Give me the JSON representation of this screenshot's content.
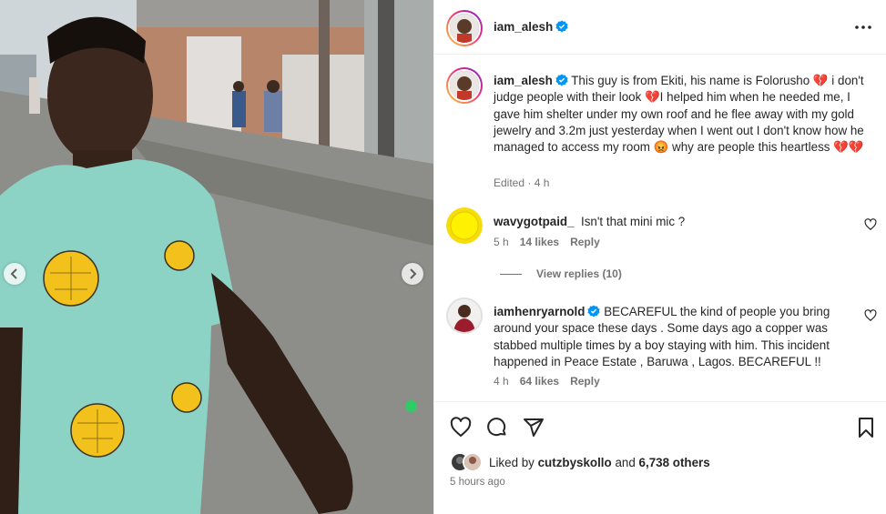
{
  "post": {
    "author": "iam_alesh",
    "caption": "This guy is from Ekiti, his name is Folorusho 💔 i don't judge people with their look 💔I helped him when he needed me, I gave him shelter under my own roof and he flee away with my gold jewelry and 3.2m just yesterday when I went out I don't know how he managed to access my room 😡 why are people this heartless 💔💔",
    "caption_meta": "Edited · 4 h"
  },
  "comments": [
    {
      "username": "wavygotpaid_",
      "text": "Isn't that mini mic ?",
      "time": "5 h",
      "likes": "14 likes",
      "reply": "Reply",
      "view_replies": "View replies (10)"
    },
    {
      "username": "iamhenryarnold",
      "text": "BECAREFUL the kind of people you bring around your space these days . Some days ago a copper was stabbed multiple times by a boy staying with him. This incident happened in Peace Estate , Baruwa , Lagos. BECAREFUL !!",
      "time": "4 h",
      "likes": "64 likes",
      "reply": "Reply"
    }
  ],
  "likes": {
    "prefix": "Liked by",
    "first_liker": "cutzbyskollo",
    "and": "and",
    "others": "6,738 others"
  },
  "time_ago": "5 hours ago",
  "icons": {
    "verified": "verified-badge-icon",
    "more": "more-options-icon",
    "like": "heart-icon",
    "comment": "comment-icon",
    "share": "share-icon",
    "save": "bookmark-icon",
    "prev": "chevron-left-icon",
    "next": "chevron-right-icon"
  },
  "colors": {
    "verified": "#0095f6",
    "text": "#262626",
    "secondary": "#737373",
    "border": "#efefef"
  }
}
